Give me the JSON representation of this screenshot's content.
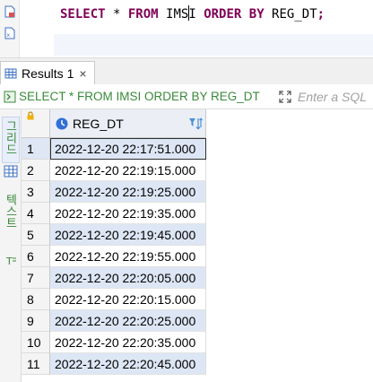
{
  "editor": {
    "tokens": [
      {
        "text": "SELECT",
        "type": "kw"
      },
      {
        "text": " * ",
        "type": "ident"
      },
      {
        "text": "FROM",
        "type": "kw"
      },
      {
        "text": " IMS",
        "type": "ident"
      },
      {
        "text": "I",
        "type": "ident"
      },
      {
        "text": " ",
        "type": "ident"
      },
      {
        "text": "ORDER BY",
        "type": "kw"
      },
      {
        "text": " REG_DT",
        "type": "ident"
      },
      {
        "text": ";",
        "type": "punct"
      }
    ]
  },
  "results_tab": {
    "label": "Results 1",
    "close_glyph": "×"
  },
  "query_bar": {
    "query_text": "SELECT * FROM IMSI ORDER BY REG_DT",
    "filter_placeholder": "Enter a SQL"
  },
  "side_panel": {
    "grid_label": "그리드",
    "text_label": "텍스트"
  },
  "grid": {
    "columns": [
      "REG_DT"
    ],
    "rows": [
      {
        "num": "1",
        "REG_DT": "2022-12-20 22:17:51.000"
      },
      {
        "num": "2",
        "REG_DT": "2022-12-20 22:19:15.000"
      },
      {
        "num": "3",
        "REG_DT": "2022-12-20 22:19:25.000"
      },
      {
        "num": "4",
        "REG_DT": "2022-12-20 22:19:35.000"
      },
      {
        "num": "5",
        "REG_DT": "2022-12-20 22:19:45.000"
      },
      {
        "num": "6",
        "REG_DT": "2022-12-20 22:19:55.000"
      },
      {
        "num": "7",
        "REG_DT": "2022-12-20 22:20:05.000"
      },
      {
        "num": "8",
        "REG_DT": "2022-12-20 22:20:15.000"
      },
      {
        "num": "9",
        "REG_DT": "2022-12-20 22:20:25.000"
      },
      {
        "num": "10",
        "REG_DT": "2022-12-20 22:20:35.000"
      },
      {
        "num": "11",
        "REG_DT": "2022-12-20 22:20:45.000"
      }
    ],
    "selected_row": 1
  },
  "icons": {
    "gutter": [
      "script-file-icon",
      "script-plan-icon"
    ],
    "tab": "results-grid-icon",
    "query": "sql-query-icon",
    "expand": "maximize-icon",
    "lock": "lock-icon",
    "column": "clock-column-icon",
    "sort": "filter-sort-icon",
    "side_grid": "grid-view-icon",
    "side_text": "text-view-icon"
  },
  "colors": {
    "keyword": "#7f0055",
    "query_text": "#3a8a3a",
    "row_stripe": "#dde6f4",
    "header_bg": "#ebeef5"
  }
}
